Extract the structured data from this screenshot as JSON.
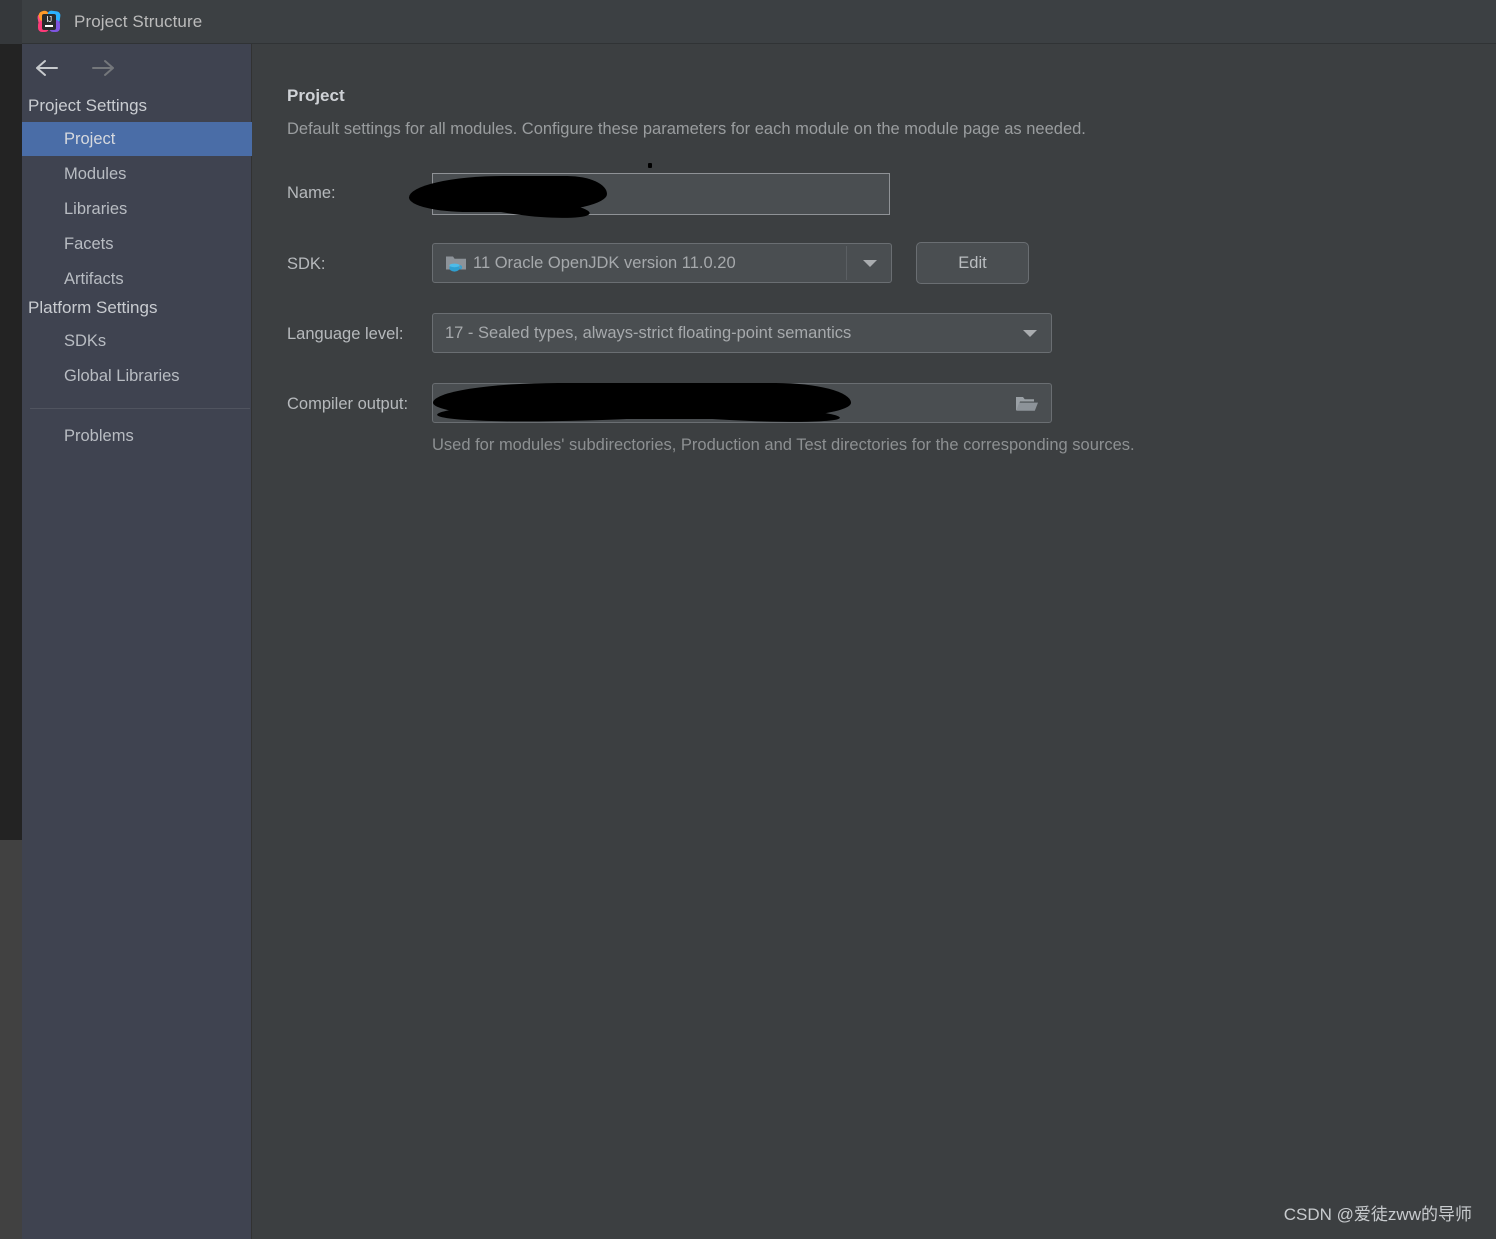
{
  "window": {
    "title": "Project Structure",
    "logo_icon": "intellij-idea-logo-icon"
  },
  "navigation": {
    "back_icon": "arrow-left-icon",
    "forward_icon": "arrow-right-icon"
  },
  "sidebar": {
    "groups": [
      {
        "title": "Project Settings",
        "items": [
          {
            "label": "Project",
            "selected": true
          },
          {
            "label": "Modules",
            "selected": false
          },
          {
            "label": "Libraries",
            "selected": false
          },
          {
            "label": "Facets",
            "selected": false
          },
          {
            "label": "Artifacts",
            "selected": false
          }
        ]
      },
      {
        "title": "Platform Settings",
        "items": [
          {
            "label": "SDKs",
            "selected": false
          },
          {
            "label": "Global Libraries",
            "selected": false
          }
        ]
      }
    ],
    "footer_items": [
      {
        "label": "Problems",
        "selected": false
      }
    ]
  },
  "main": {
    "title": "Project",
    "description": "Default settings for all modules. Configure these parameters for each module on the module page as needed.",
    "fields": {
      "name": {
        "label": "Name:",
        "value": "",
        "redacted": true
      },
      "sdk": {
        "label": "SDK:",
        "value": "11 Oracle OpenJDK version 11.0.20",
        "icon": "jdk-folder-icon",
        "caret_icon": "chevron-down-icon",
        "edit_button": "Edit"
      },
      "language_level": {
        "label": "Language level:",
        "value": "17 - Sealed types, always-strict floating-point semantics",
        "caret_icon": "chevron-down-icon"
      },
      "compiler_output": {
        "label": "Compiler output:",
        "value": "",
        "redacted": true,
        "browse_icon": "folder-open-icon",
        "hint": "Used for modules' subdirectories, Production and Test directories for the corresponding sources."
      }
    }
  },
  "watermark": {
    "text": "CSDN @爱徒zww的导师"
  },
  "colors": {
    "accent_selection": "#4a6da7",
    "sidebar_bg": "#3f4350",
    "content_bg": "#3c3f41",
    "titlebar_bg": "#3c4043",
    "field_bg": "#4a4e51"
  }
}
